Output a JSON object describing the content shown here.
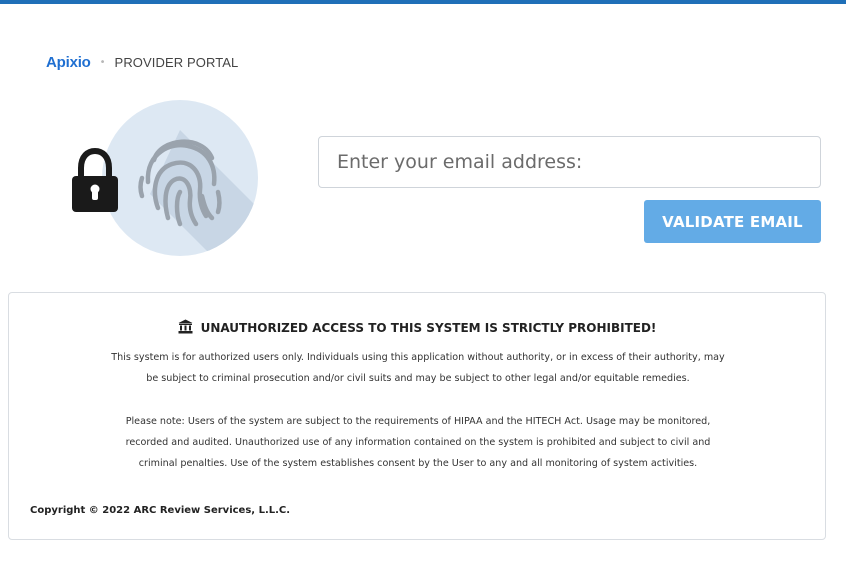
{
  "header": {
    "brand": "Apixio",
    "separator": "•",
    "subtitle": "PROVIDER PORTAL"
  },
  "login": {
    "email_placeholder": "Enter your email address:",
    "validate_label": "VALIDATE EMAIL"
  },
  "notice": {
    "title": "UNAUTHORIZED ACCESS TO THIS SYSTEM IS STRICTLY PROHIBITED!",
    "p1_line1": "This system is for authorized users only. Individuals using this application without authority, or in excess of their authority, may",
    "p1_line2": "be subject to criminal prosecution and/or civil suits and may be subject to other legal and/or equitable remedies.",
    "p2_line1": "Please note: Users of the system are subject to the requirements of HIPAA and the HITECH Act. Usage may be monitored,",
    "p2_line2": "recorded and audited. Unauthorized use of any information contained on the system is prohibited and subject to civil and",
    "p2_line3": "criminal penalties. Use of the system establishes consent by the User to any and all monitoring of system activities.",
    "copyright": "Copyright © 2022 ARC Review Services, L.L.C."
  },
  "icons": {
    "lock": "lock-icon",
    "fingerprint": "fingerprint-icon",
    "bank": "bank-icon"
  },
  "colors": {
    "accent": "#1f6fb8",
    "brand": "#1f6fd1",
    "button": "#63abe6",
    "circle": "#dde8f3"
  }
}
